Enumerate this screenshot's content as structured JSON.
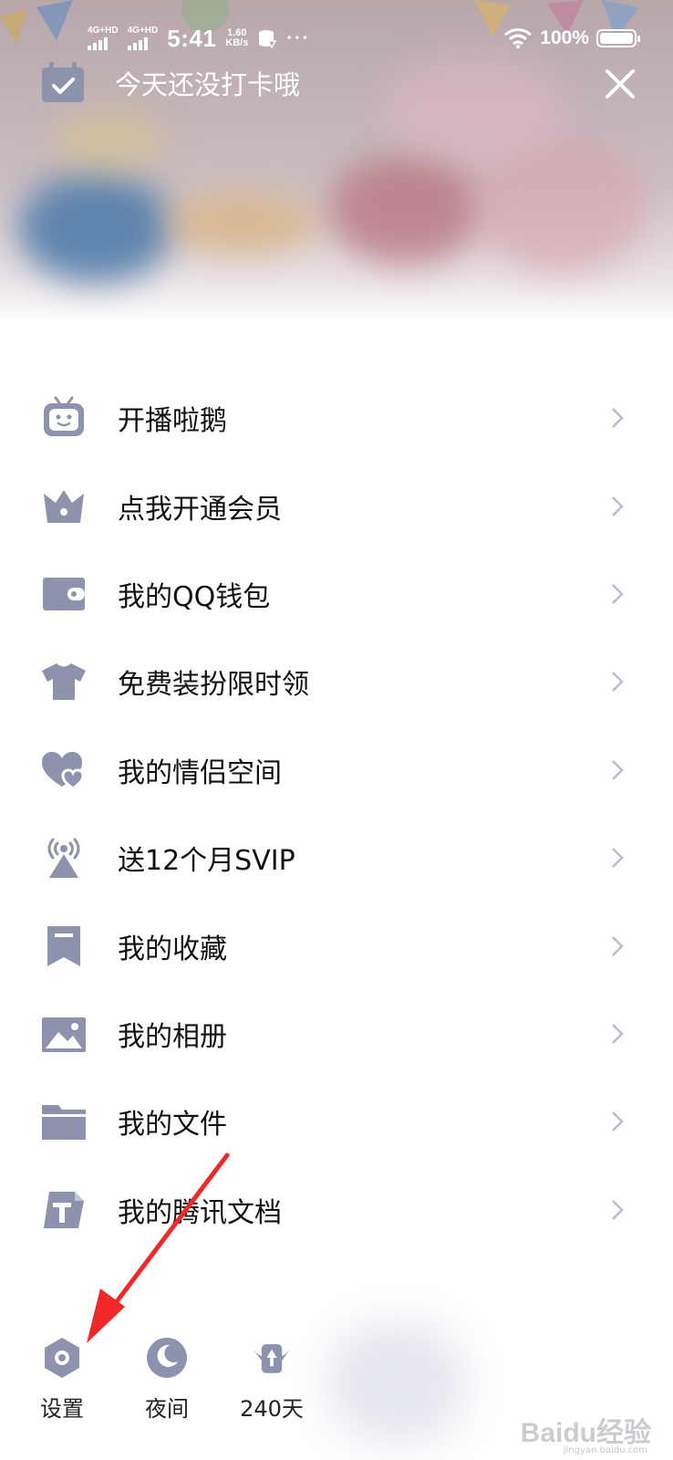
{
  "status_bar": {
    "network_1": "4G+HD",
    "network_2": "4G+HD",
    "time": "5:41",
    "speed_value": "1.60",
    "speed_unit": "KB/s",
    "more": "···",
    "battery": "100%"
  },
  "header": {
    "checkin_text": "今天还没打卡哦",
    "calendar_icon": "calendar-check-icon",
    "close_icon": "close-icon"
  },
  "menu": {
    "items": [
      {
        "label": "开播啦鹅",
        "icon": "tv-robot-icon"
      },
      {
        "label": "点我开通会员",
        "icon": "crown-icon"
      },
      {
        "label": "我的QQ钱包",
        "icon": "wallet-icon"
      },
      {
        "label": "免费装扮限时领",
        "icon": "tshirt-icon"
      },
      {
        "label": "我的情侣空间",
        "icon": "hearts-icon"
      },
      {
        "label": "送12个月SVIP",
        "icon": "broadcast-icon"
      },
      {
        "label": "我的收藏",
        "icon": "bookmark-icon"
      },
      {
        "label": "我的相册",
        "icon": "photo-icon"
      },
      {
        "label": "我的文件",
        "icon": "folder-icon"
      },
      {
        "label": "我的腾讯文档",
        "icon": "document-icon"
      }
    ]
  },
  "bottom_bar": {
    "settings": "设置",
    "night": "夜间",
    "days": "240天"
  },
  "watermark": {
    "brand": "Baidu经验",
    "url": "jingyan.baidu.com"
  },
  "colors": {
    "icon": "#8d93ad",
    "chevron": "#b9bccb",
    "annotation_arrow": "#f0282a"
  }
}
